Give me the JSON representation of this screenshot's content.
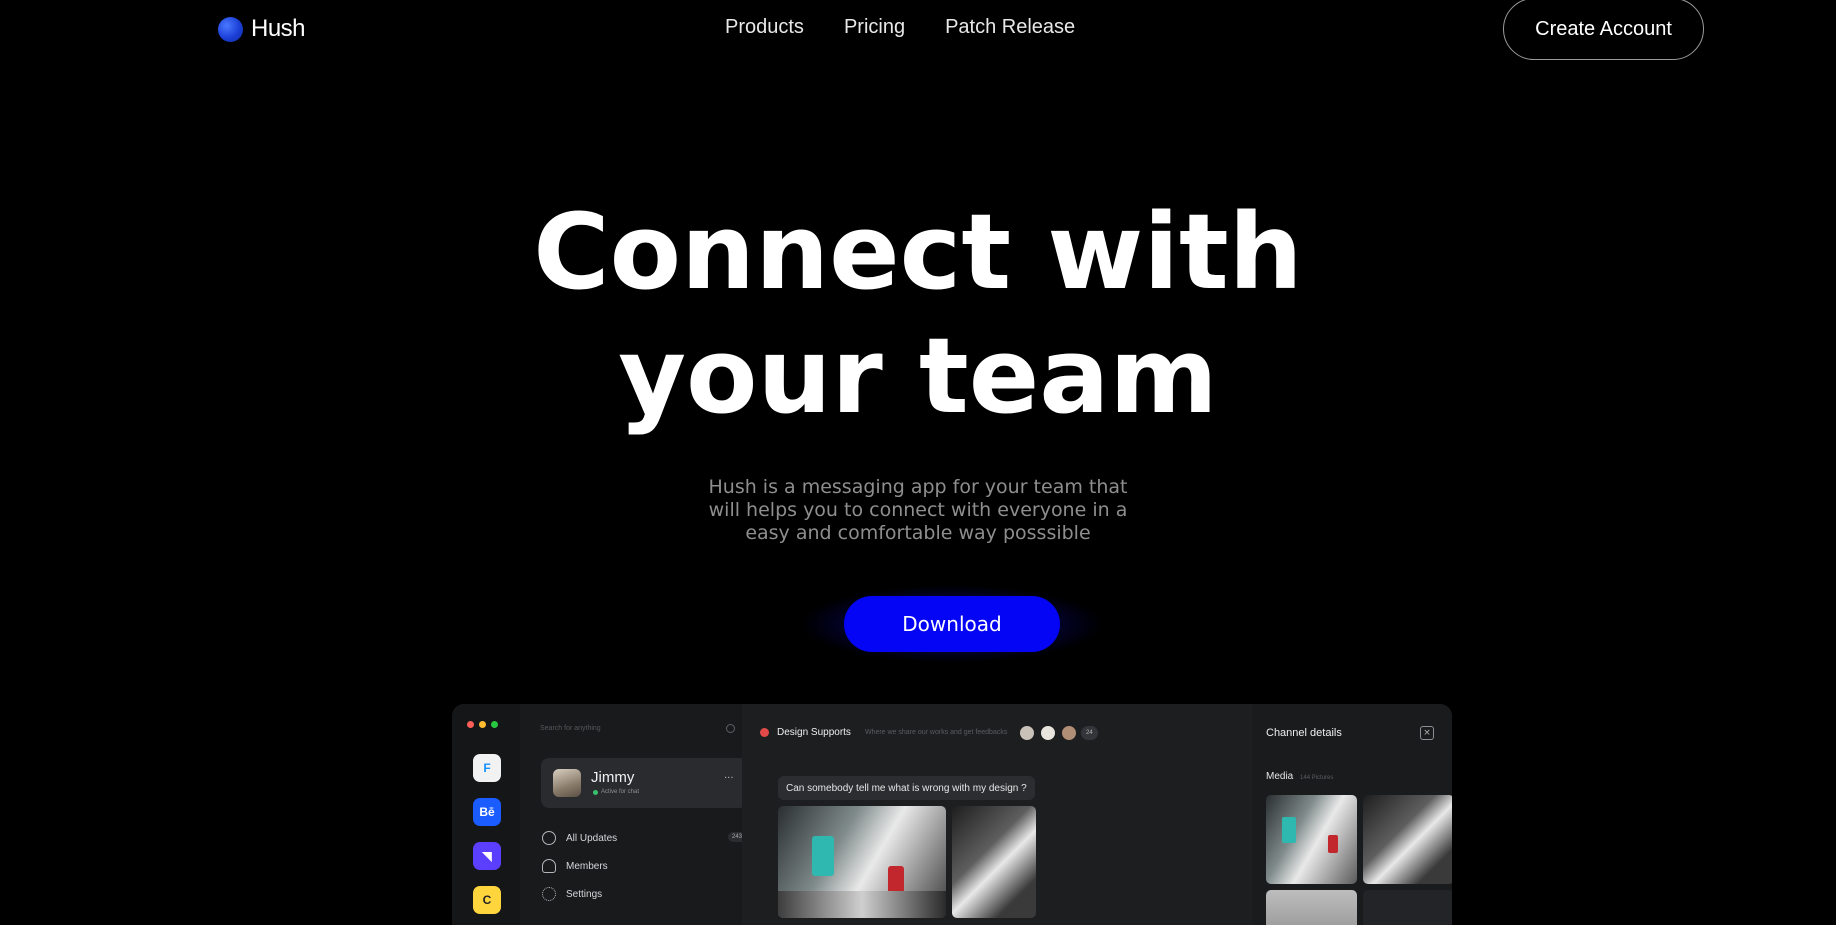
{
  "nav": {
    "brand": "Hush",
    "links": [
      "Products",
      "Pricing",
      "Patch Release"
    ],
    "cta": "Create Account"
  },
  "hero": {
    "title_line1": "Connect with",
    "title_line2": "your team",
    "subtitle": "Hush is a messaging app for your team that will helps you to connect with everyone in a easy and comfortable way posssible",
    "download_label": "Download"
  },
  "colors": {
    "background": "#000000",
    "accent": "#0505f5",
    "brand_dot": "#1b3fd6",
    "muted_text": "#8e8e8e"
  },
  "app_preview": {
    "rail_icons": [
      {
        "name": "framer-icon",
        "glyph": "F",
        "bg": "#f2f2f2",
        "fg": "#1593ff"
      },
      {
        "name": "behance-icon",
        "glyph": "Bē",
        "bg": "#1a5cff",
        "fg": "#ffffff"
      },
      {
        "name": "linear-icon",
        "glyph": "◥",
        "bg": "#5a3fff",
        "fg": "#ffffff"
      },
      {
        "name": "mailchimp-icon",
        "glyph": "C",
        "bg": "#ffd53d",
        "fg": "#222222"
      }
    ],
    "search_placeholder": "Search for anything",
    "user": {
      "name": "Jimmy",
      "status": "Active for chat",
      "more": "···"
    },
    "menu": [
      {
        "label": "All Updates",
        "icon": "clock-icon"
      },
      {
        "label": "Members",
        "icon": "user-icon"
      },
      {
        "label": "Settings",
        "icon": "gear-icon"
      }
    ],
    "updates_count": "243",
    "channel": {
      "title": "Design Supports",
      "description": "Where we share our works and get feedbacks",
      "member_count": "24"
    },
    "message": "Can somebody tell me what is wrong with my design ?",
    "details": {
      "title": "Channel details",
      "media_label": "Media",
      "media_sub": "144 Pictures"
    }
  }
}
